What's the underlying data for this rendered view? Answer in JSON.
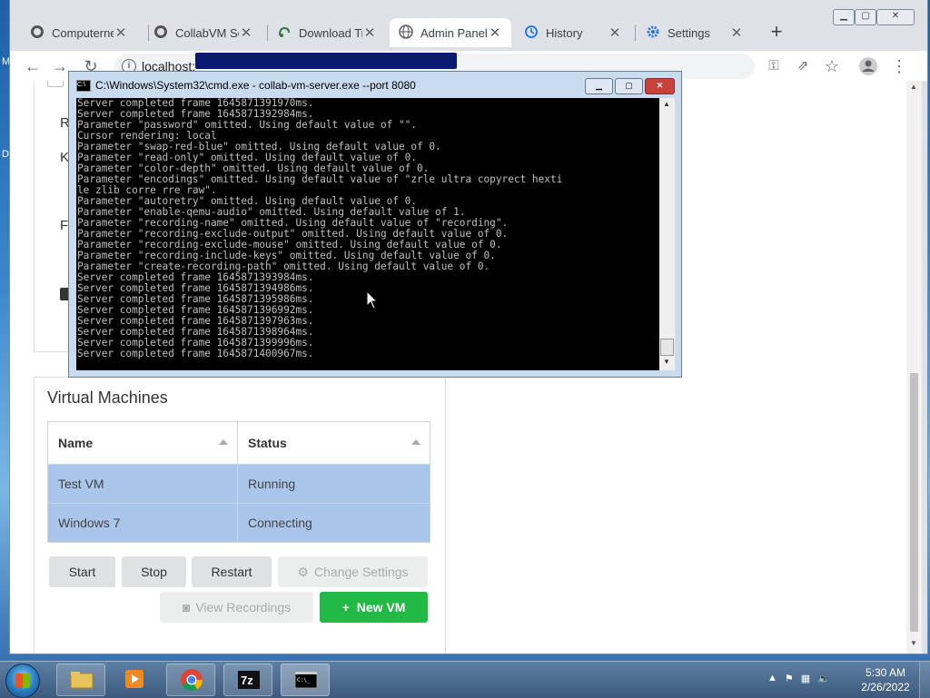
{
  "browser": {
    "tabs": [
      {
        "title": "Computernest",
        "icon": "github-icon"
      },
      {
        "title": "CollabVM Se",
        "icon": "github-icon"
      },
      {
        "title": "Download Ti",
        "icon": "download-icon"
      },
      {
        "title": "Admin Panel",
        "icon": "globe-icon",
        "active": true
      },
      {
        "title": "History",
        "icon": "history-icon"
      },
      {
        "title": "Settings",
        "icon": "gear-icon"
      }
    ],
    "new_tab": "+",
    "url": "localhost:",
    "window_controls": {
      "minimize": "▁",
      "maximize": "▢",
      "close": "✕"
    }
  },
  "page": {
    "top_card_fragments": [
      "R",
      "K",
      "F"
    ],
    "vm_section": {
      "title": "Virtual Machines",
      "columns": [
        "Name",
        "Status"
      ],
      "rows": [
        {
          "name": "Test VM",
          "status": "Running"
        },
        {
          "name": "Windows 7",
          "status": "Connecting"
        }
      ],
      "buttons": {
        "start": "Start",
        "stop": "Stop",
        "restart": "Restart",
        "change_settings": "Change Settings",
        "view_recordings": "View Recordings",
        "new_vm": "New VM"
      }
    }
  },
  "cmd": {
    "title": "C:\\Windows\\System32\\cmd.exe - collab-vm-server.exe  --port 8080",
    "icon_text": "C:\\",
    "lines": [
      "Server completed frame 1645871391970ms.",
      "Server completed frame 1645871392984ms.",
      "Parameter \"password\" omitted. Using default value of \"\".",
      "Cursor rendering: local",
      "Parameter \"swap-red-blue\" omitted. Using default value of 0.",
      "Parameter \"read-only\" omitted. Using default value of 0.",
      "Parameter \"color-depth\" omitted. Using default value of 0.",
      "Parameter \"encodings\" omitted. Using default value of \"zrle ultra copyrect hexti",
      "le zlib corre rre raw\".",
      "Parameter \"autoretry\" omitted. Using default value of 0.",
      "Parameter \"enable-qemu-audio\" omitted. Using default value of 1.",
      "Parameter \"recording-name\" omitted. Using default value of \"recording\".",
      "Parameter \"recording-exclude-output\" omitted. Using default value of 0.",
      "Parameter \"recording-exclude-mouse\" omitted. Using default value of 0.",
      "Parameter \"recording-include-keys\" omitted. Using default value of 0.",
      "Parameter \"create-recording-path\" omitted. Using default value of 0.",
      "Server completed frame 1645871393984ms.",
      "Server completed frame 1645871394986ms.",
      "Server completed frame 1645871395986ms.",
      "Server completed frame 1645871396992ms.",
      "Server completed frame 1645871397963ms.",
      "Server completed frame 1645871398964ms.",
      "Server completed frame 1645871399996ms.",
      "Server completed frame 1645871400967ms."
    ]
  },
  "taskbar": {
    "items": [
      "explorer-icon",
      "media-player-icon",
      "chrome-icon",
      "7zip-icon",
      "cmd-icon"
    ],
    "time": "5:30 AM",
    "date": "2/26/2022"
  },
  "desktop_fragments": [
    "M",
    "D"
  ]
}
